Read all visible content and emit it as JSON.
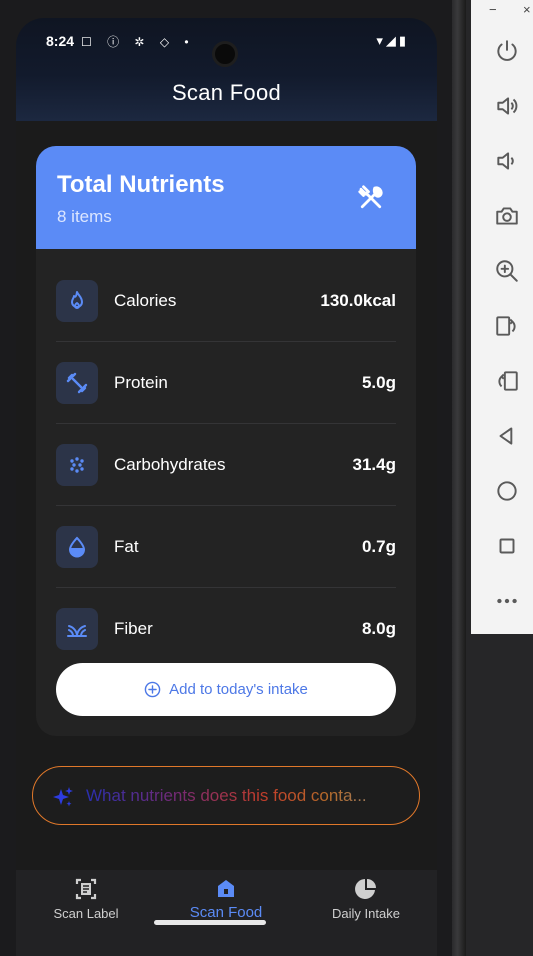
{
  "status": {
    "time": "8:24",
    "left_icons": "☐ ⓘ ✲ ◇ •",
    "right_icons": "▾◢▮"
  },
  "header": {
    "title": "Scan Food"
  },
  "card": {
    "title": "Total Nutrients",
    "subtitle": "8 items",
    "header_icon": "utensils-crossed-icon",
    "rows": [
      {
        "label": "Calories",
        "value": "130.0kcal",
        "icon": "flame-icon"
      },
      {
        "label": "Protein",
        "value": "5.0g",
        "icon": "dumbbell-icon"
      },
      {
        "label": "Carbohydrates",
        "value": "31.4g",
        "icon": "grain-dots-icon"
      },
      {
        "label": "Fat",
        "value": "0.7g",
        "icon": "droplet-icon"
      },
      {
        "label": "Fiber",
        "value": "8.0g",
        "icon": "sprout-icon"
      }
    ],
    "add_button": "Add to today's intake"
  },
  "prompt": {
    "text": "What nutrients does this food conta...",
    "icon": "sparkles-icon"
  },
  "nav": {
    "items": [
      {
        "label": "Scan Label",
        "icon": "scan-label-icon"
      },
      {
        "label": "Scan Food",
        "icon": "food-basket-icon",
        "active": true
      },
      {
        "label": "Daily Intake",
        "icon": "pie-chart-icon"
      }
    ]
  },
  "emulator": {
    "window_controls": [
      "−",
      "×"
    ],
    "buttons": [
      "power-icon",
      "volume-up-icon",
      "volume-down-icon",
      "camera-icon",
      "zoom-in-icon",
      "rotate-left-icon",
      "rotate-right-icon",
      "back-icon",
      "home-icon",
      "overview-icon",
      "more-icon"
    ]
  },
  "colors": {
    "accent": "#5b8bf6",
    "card_bg": "#232323",
    "screen_bg": "#1b1b1b",
    "prompt_border": "#e0782a"
  }
}
